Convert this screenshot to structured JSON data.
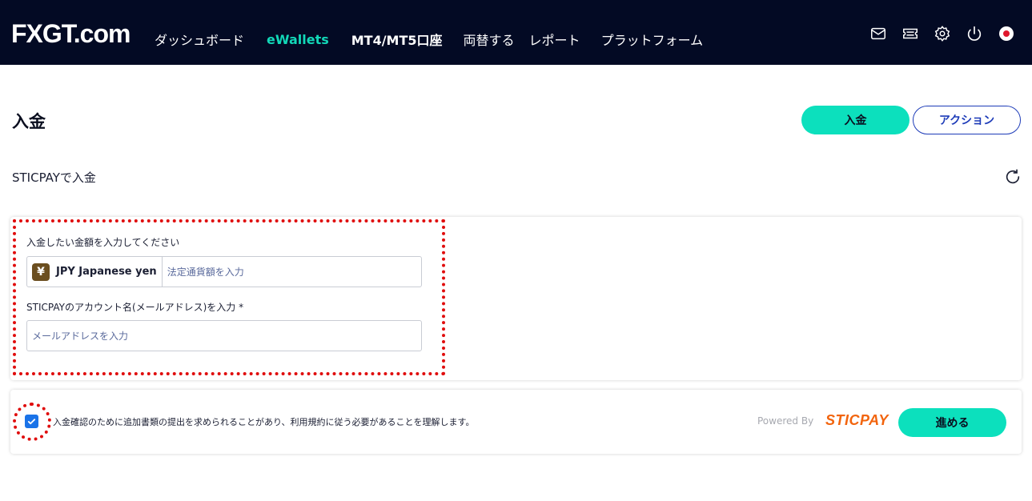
{
  "header": {
    "logo_text": "FXGT.com",
    "nav": [
      {
        "label": "ダッシュボード",
        "active": false
      },
      {
        "label": "eWallets",
        "active": true
      },
      {
        "label": "MT4/MT5口座",
        "active": false
      },
      {
        "label": "両替する",
        "active": false
      },
      {
        "label": "レポート",
        "active": false
      },
      {
        "label": "プラットフォーム",
        "active": false
      }
    ],
    "icons": [
      "mail-icon",
      "ticket-icon",
      "gear-icon",
      "power-icon",
      "japan-flag-icon"
    ],
    "active_color": "#12d8b8",
    "background": "#030a24"
  },
  "page": {
    "title": "入金",
    "deposit_button": "入金",
    "action_button": "アクション",
    "subtitle": "STICPAYで入金"
  },
  "form": {
    "amount_label": "入金したい金額を入力してください",
    "currency_symbol": "¥",
    "currency_label": "JPY Japanese yen",
    "amount_placeholder": "法定通貨額を入力",
    "account_label": "STICPAYのアカウント名(メールアドレス)を入力 *",
    "email_placeholder": "メールアドレスを入力"
  },
  "footer": {
    "checkbox_checked": true,
    "terms_text": "入金確認のために追加書類の提出を求められることがあり、利用規約に従う必要があることを理解します。",
    "powered_by": "Powered By",
    "provider_logo": "STICPAY",
    "next_button": "進める"
  },
  "colors": {
    "primary_button": "#0ce0bd",
    "outline_button": "#1d3bb8",
    "highlight_red": "#e00d0d",
    "sticpay_orange": "#f2640d"
  }
}
